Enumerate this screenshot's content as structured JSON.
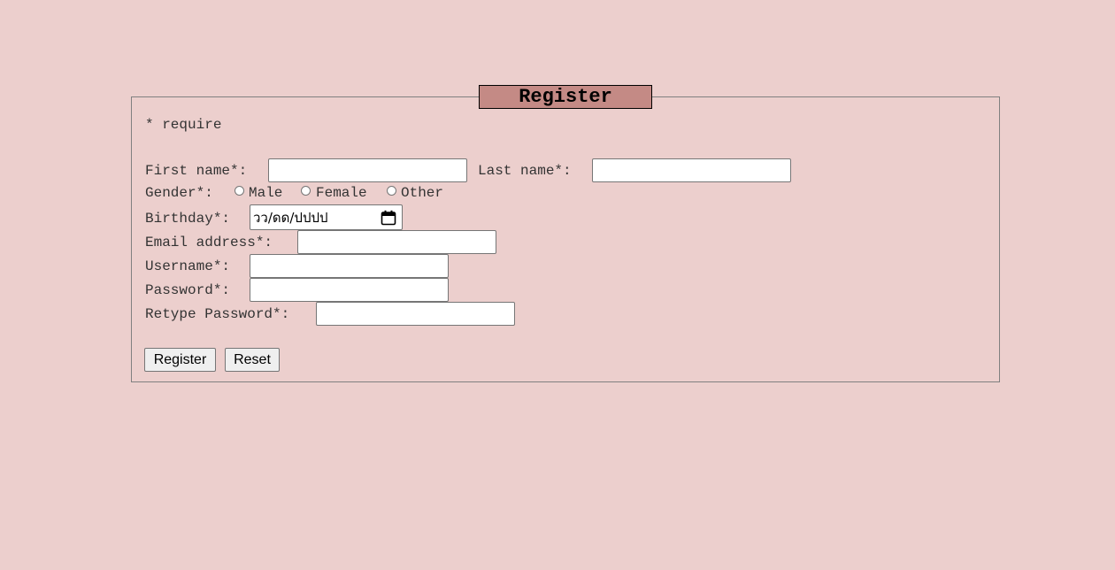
{
  "form": {
    "legend": "Register",
    "require_note": "* require",
    "first_name": {
      "label": "First name*:",
      "value": ""
    },
    "last_name": {
      "label": "Last name*:",
      "value": ""
    },
    "gender": {
      "label": "Gender*:",
      "options": [
        "Male",
        "Female",
        "Other"
      ]
    },
    "birthday": {
      "label": "Birthday*:",
      "placeholder": "วว/ดด/ปปปป",
      "icon": "calendar-icon"
    },
    "email": {
      "label": "Email address*:",
      "value": ""
    },
    "username": {
      "label": "Username*:",
      "value": ""
    },
    "password": {
      "label": "Password*:",
      "value": ""
    },
    "retype_password": {
      "label": "Retype Password*:",
      "value": ""
    },
    "buttons": {
      "register": "Register",
      "reset": "Reset"
    }
  },
  "colors": {
    "background": "#eccfcd",
    "legend_background": "#c48a85"
  }
}
